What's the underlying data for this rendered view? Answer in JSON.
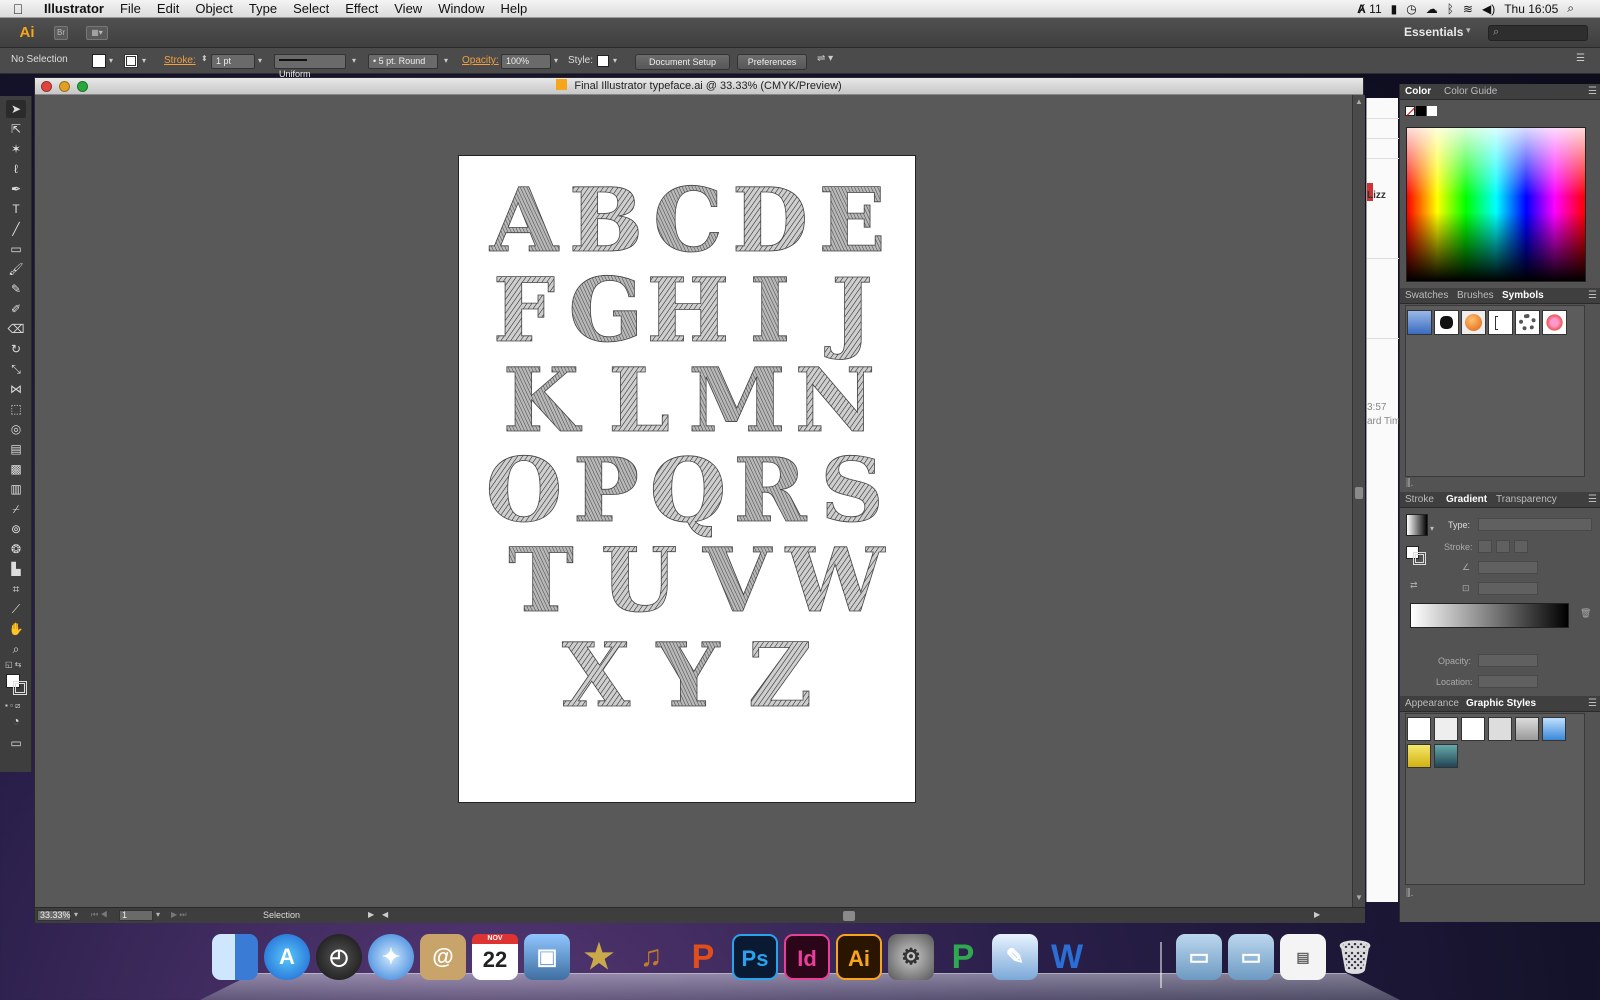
{
  "menubar": {
    "app_name": "Illustrator",
    "items": [
      "File",
      "Edit",
      "Object",
      "Type",
      "Select",
      "Effect",
      "View",
      "Window",
      "Help"
    ],
    "status_adobe_count": "11",
    "clock": "Thu 16:05"
  },
  "appbar": {
    "logo": "Ai",
    "bridge_label": "Br",
    "workspace": "Essentials"
  },
  "controlbar": {
    "selection": "No Selection",
    "stroke_label": "Stroke:",
    "stroke_weight": "1 pt",
    "stroke_profile": "Uniform",
    "brush": "5 pt. Round",
    "opacity_label": "Opacity:",
    "opacity_value": "100%",
    "style_label": "Style:",
    "document_setup": "Document Setup",
    "preferences": "Preferences"
  },
  "document": {
    "title": "Final Illustrator typeface.ai @ 33.33% (CMYK/Preview)",
    "zoom": "33.33%",
    "artboard_number": "1",
    "status_tool": "Selection",
    "alphabet_rows": [
      "ABCDE",
      "FGHIJ",
      "KLMN",
      "OPQRS",
      "TUVW",
      "XYZ"
    ]
  },
  "background_app": {
    "label": "Lizz",
    "time_fragment": "3:57",
    "zone_fragment": "ard Tim"
  },
  "panels": {
    "color_tabs": [
      "Color",
      "Color Guide"
    ],
    "swatch_tabs": [
      "Swatches",
      "Brushes",
      "Symbols"
    ],
    "gradient_tabs": [
      "Stroke",
      "Gradient",
      "Transparency"
    ],
    "gradient_type_label": "Type:",
    "gradient_stroke_label": "Stroke:",
    "gradient_opacity_label": "Opacity:",
    "gradient_location_label": "Location:",
    "appearance_tabs": [
      "Appearance",
      "Graphic Styles"
    ]
  },
  "dock": {
    "items": [
      "Finder",
      "App Store",
      "Dashboard",
      "Safari",
      "Contacts",
      "Calendar",
      "iPhoto",
      "iMovie",
      "GarageBand",
      "PowerPoint",
      "Photoshop",
      "InDesign",
      "Illustrator",
      "System Preferences",
      "Project",
      "Preview",
      "Word",
      "Applications",
      "Documents",
      "Downloads",
      "Trash"
    ],
    "calendar_month": "NOV",
    "calendar_day": "22",
    "photoshop_label": "Ps",
    "indesign_label": "Id",
    "illustrator_label": "Ai",
    "project_label": "P",
    "word_label": "W",
    "powerpoint_label": "P"
  },
  "colors": {
    "ai_orange": "#f7a51b",
    "ps_blue": "#2aa3ef",
    "id_pink": "#e8409a",
    "ui_dark": "#3f3f3f",
    "canvas": "#595959"
  }
}
